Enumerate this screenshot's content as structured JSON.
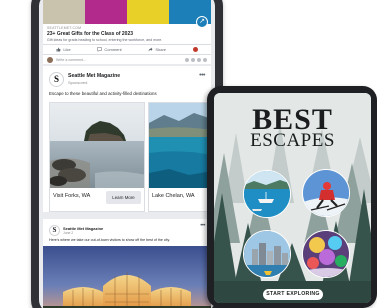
{
  "feed": {
    "top_post": {
      "source": "SEATTLEMET.COM",
      "title": "23+ Great Gifts for the Class of 2023",
      "description": "Gift ideas for grads heading to school, entering the workforce, and more.",
      "actions": {
        "like": "Like",
        "comment": "Comment",
        "share": "Share"
      },
      "comment_placeholder": "Write a comment..."
    },
    "ad": {
      "logo_letter": "S",
      "page_name": "Seattle Met Magazine",
      "sponsored": "Sponsored",
      "text": "Escape to these beautiful and activity-filled destinations",
      "cards": [
        {
          "caption": "Visit Forks, WA",
          "button": "Learn More"
        },
        {
          "caption": "Lake Chelan, WA"
        }
      ]
    },
    "post": {
      "logo_letter": "S",
      "page_name": "Seattle Met Magazine",
      "date": "June 2",
      "text": "Here's where we take our out-of-town visitors to show off the best of the city."
    }
  },
  "escapes": {
    "title_line1": "BEST",
    "title_line2": "ESCAPES",
    "button": "START EXPLORING"
  },
  "colors": {
    "fb_bg": "#e9ebee",
    "device_dark": "#2f3136",
    "forest_dark": "#37544c",
    "accent_blue": "#1d7fb8"
  }
}
